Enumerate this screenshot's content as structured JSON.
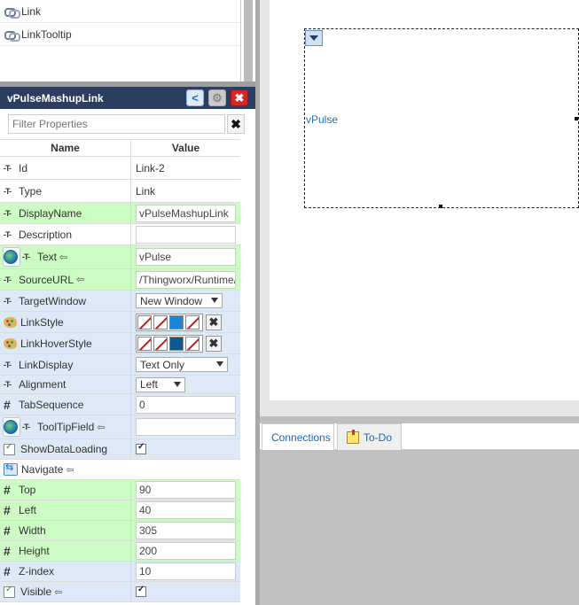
{
  "widget_list": {
    "items": [
      {
        "label": "Link",
        "icon": "link-icon"
      },
      {
        "label": "LinkTooltip",
        "icon": "link-icon"
      }
    ]
  },
  "properties_panel": {
    "title": "vPulseMashupLink",
    "buttons": {
      "share": "share-icon",
      "settings": "gear-icon",
      "close": "close-icon"
    },
    "filter": {
      "placeholder": "Filter Properties",
      "clear": "✖"
    },
    "columns": {
      "name": "Name",
      "value": "Value"
    },
    "rows": {
      "id": {
        "name": "Id",
        "value": "Link-2"
      },
      "type": {
        "name": "Type",
        "value": "Link"
      },
      "displayname": {
        "name": "DisplayName",
        "value": "vPulseMashupLink"
      },
      "description": {
        "name": "Description",
        "value": ""
      },
      "text": {
        "name": "Text",
        "value": "vPulse"
      },
      "sourceurl": {
        "name": "SourceURL",
        "value": "/Thingworx/Runtime/i"
      },
      "targetwindow": {
        "name": "TargetWindow",
        "value": "New Window"
      },
      "linkstyle": {
        "name": "LinkStyle"
      },
      "linkhoverstyle": {
        "name": "LinkHoverStyle"
      },
      "linkdisplay": {
        "name": "LinkDisplay",
        "value": "Text Only"
      },
      "alignment": {
        "name": "Alignment",
        "value": "Left"
      },
      "tabsequence": {
        "name": "TabSequence",
        "value": "0"
      },
      "tooltipfield": {
        "name": "ToolTipField",
        "value": ""
      },
      "showdataloading": {
        "name": "ShowDataLoading",
        "checked": true
      },
      "navigate": {
        "name": "Navigate"
      },
      "top": {
        "name": "Top",
        "value": "90"
      },
      "left": {
        "name": "Left",
        "value": "40"
      },
      "width": {
        "name": "Width",
        "value": "305"
      },
      "height": {
        "name": "Height",
        "value": "200"
      },
      "zindex": {
        "name": "Z-index",
        "value": "10"
      },
      "visible": {
        "name": "Visible",
        "checked": true
      }
    },
    "colors": {
      "header_bg": "#2b3e5f",
      "row_green": "#ccfbc4",
      "row_blue": "#dde9f6",
      "swatch_blue": "#1a86d8",
      "swatch_dark_blue": "#0e5a8f"
    }
  },
  "canvas": {
    "link_text": "vPulse",
    "menu_icon": "chevron-down-icon"
  },
  "bottom_tabs": [
    {
      "label": "Connections",
      "active": true
    },
    {
      "label": "To-Do",
      "icon": "note-icon",
      "active": false
    }
  ]
}
